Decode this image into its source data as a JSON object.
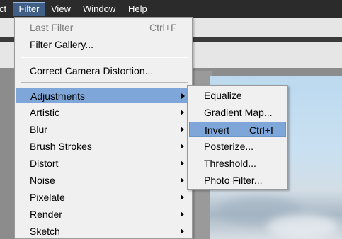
{
  "menubar": {
    "items": [
      {
        "label": "ct"
      },
      {
        "label": "Filter"
      },
      {
        "label": "View"
      },
      {
        "label": "Window"
      },
      {
        "label": "Help"
      }
    ]
  },
  "filter_menu": {
    "last_filter": {
      "label": "Last Filter",
      "shortcut": "Ctrl+F"
    },
    "filter_gallery": {
      "label": "Filter Gallery..."
    },
    "correct_camera": {
      "label": "Correct Camera Distortion..."
    },
    "submenus": [
      {
        "label": "Adjustments"
      },
      {
        "label": "Artistic"
      },
      {
        "label": "Blur"
      },
      {
        "label": "Brush Strokes"
      },
      {
        "label": "Distort"
      },
      {
        "label": "Noise"
      },
      {
        "label": "Pixelate"
      },
      {
        "label": "Render"
      },
      {
        "label": "Sketch"
      }
    ]
  },
  "adjustments_submenu": {
    "items": [
      {
        "label": "Equalize",
        "shortcut": ""
      },
      {
        "label": "Gradient Map...",
        "shortcut": ""
      },
      {
        "label": "Invert",
        "shortcut": "Ctrl+I"
      },
      {
        "label": "Posterize...",
        "shortcut": ""
      },
      {
        "label": "Threshold...",
        "shortcut": ""
      },
      {
        "label": "Photo Filter...",
        "shortcut": ""
      }
    ]
  },
  "colors": {
    "menubar_bg": "#2b2b2b",
    "highlight": "#7ea6d8",
    "menu_bg": "#f0f0f0",
    "disabled_text": "#7d7d7d"
  }
}
